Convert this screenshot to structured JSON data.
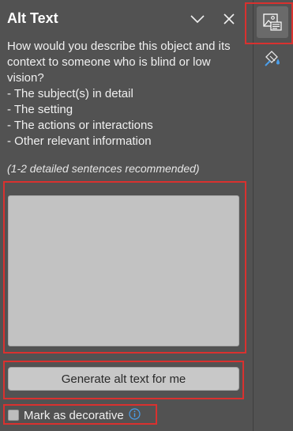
{
  "pane": {
    "title": "Alt Text",
    "collapse_icon": "chevron-down-icon",
    "close_icon": "close-icon"
  },
  "description": {
    "intro": "How would you describe this object and its context to someone who is blind or low vision?",
    "bullets": [
      "- The subject(s) in detail",
      "- The setting",
      "- The actions or interactions",
      "- Other relevant information"
    ],
    "hint": "(1-2 detailed sentences recommended)"
  },
  "alt_text_input": {
    "value": "",
    "placeholder": ""
  },
  "generate_button": {
    "label": "Generate alt text for me"
  },
  "decorative": {
    "label": "Mark as decorative",
    "checked": false,
    "info_icon": "info-icon"
  },
  "side_rail": {
    "items": [
      {
        "icon": "alt-text-image-icon",
        "selected": true
      },
      {
        "icon": "format-shape-icon",
        "selected": false
      }
    ]
  },
  "colors": {
    "pane_background": "#525252",
    "highlight_outline": "#d9312f",
    "info_accent": "#4a9eea"
  }
}
